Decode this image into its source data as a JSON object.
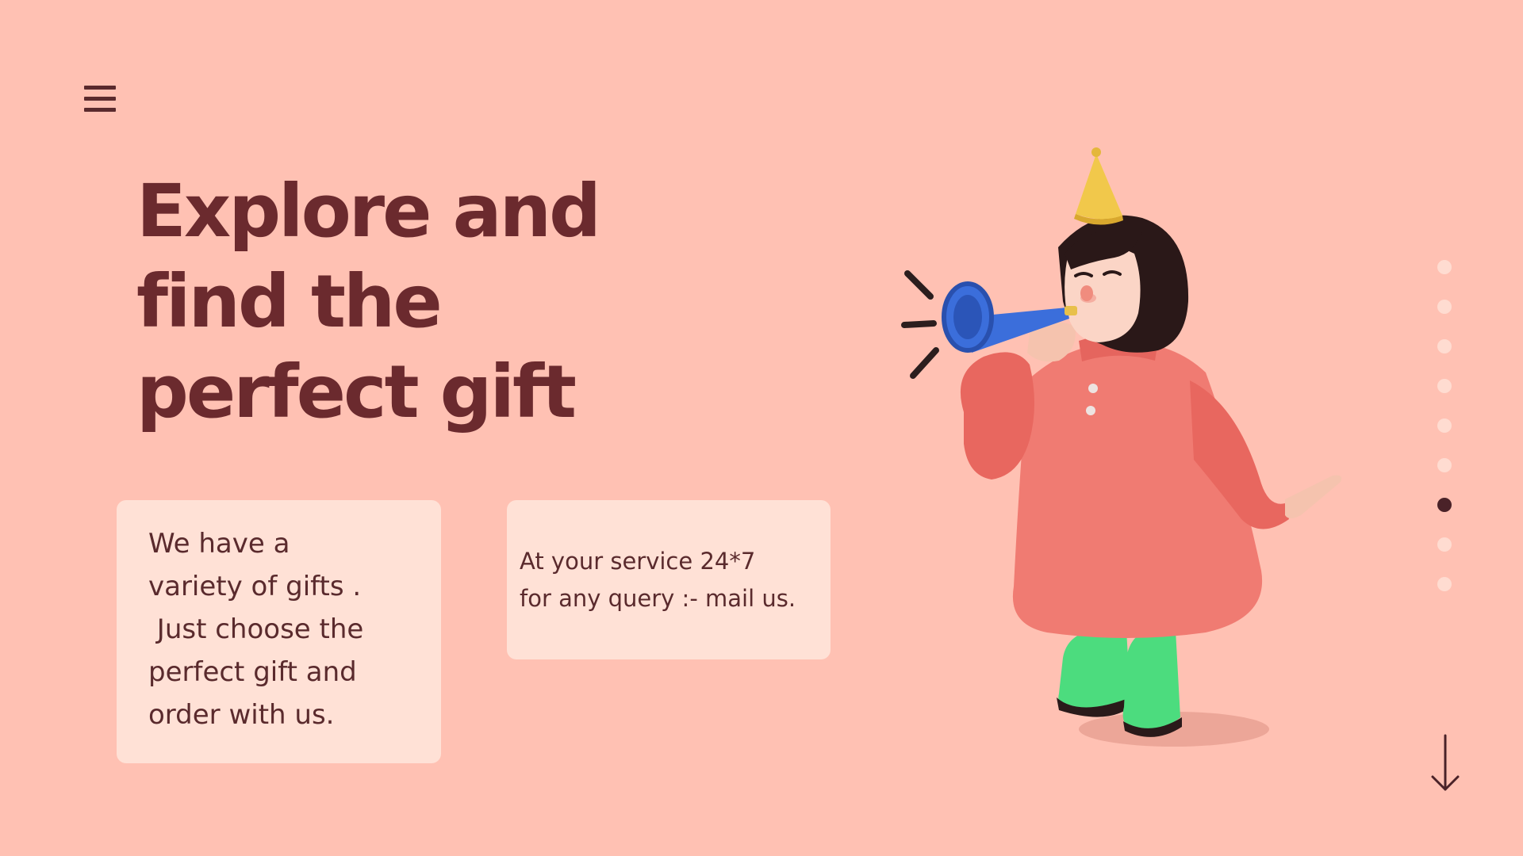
{
  "menu": {
    "icon": "hamburger-menu-icon"
  },
  "hero": {
    "title_lines": [
      "Explore and",
      "find the",
      "perfect gift"
    ]
  },
  "cards": {
    "variety": {
      "lines": [
        "We have a",
        "variety of gifts .",
        " Just choose the",
        "perfect gift and",
        "order with us."
      ]
    },
    "service": {
      "lines": [
        "At your service 24*7",
        "for any query :- mail us."
      ]
    }
  },
  "illustration": {
    "subject": "girl-blowing-party-horn-illustration"
  },
  "pagination": {
    "count": 9,
    "active_index": 6
  },
  "scroll": {
    "icon": "arrow-down-icon"
  },
  "colors": {
    "background": "#FFC1B3",
    "card": "#FFE1D6",
    "text": "#6B2A2E",
    "dot": "#FFDCD1",
    "dot_active": "#4A2228"
  }
}
